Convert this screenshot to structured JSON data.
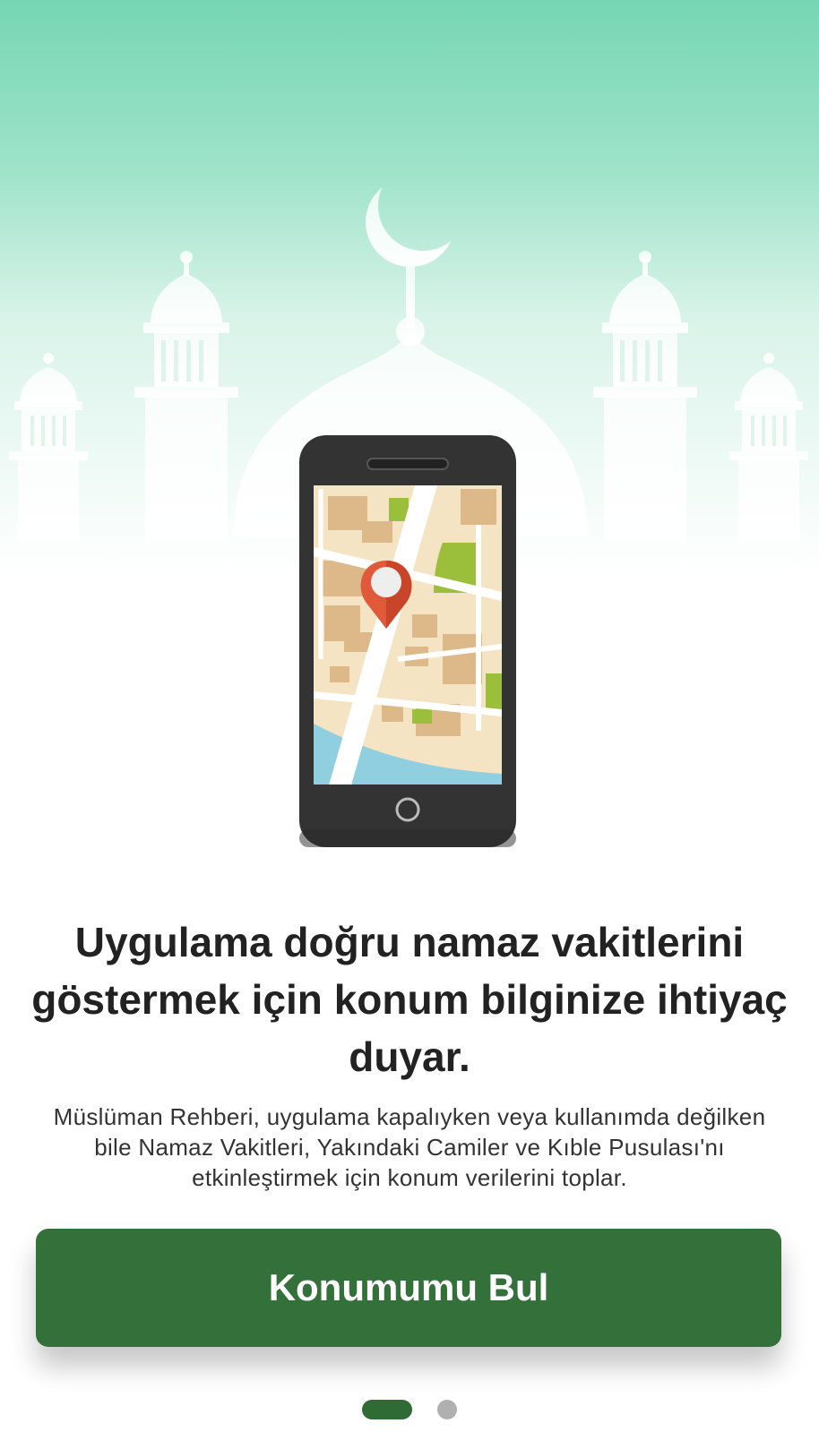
{
  "onboarding": {
    "illustration": {
      "background": "mosque-silhouette",
      "phone": "map-with-location-pin",
      "colors": {
        "sky_top": "#76d6b4",
        "pin": "#e05a3a",
        "phone_body": "#333333",
        "map_base": "#f4e4c4"
      }
    },
    "title": "Uygulama doğru namaz vakitlerini göstermek için konum bilginize ihtiyaç duyar.",
    "description": "Müslüman Rehberi, uygulama kapalıyken veya kullanımda değilken bile Namaz Vakitleri, Yakındaki Camiler ve Kıble Pusulası'nı etkinleştirmek için konum verilerini toplar.",
    "cta_label": "Konumumu Bul",
    "cta_color": "#33703a",
    "pager": {
      "total": 2,
      "active": 1
    }
  }
}
